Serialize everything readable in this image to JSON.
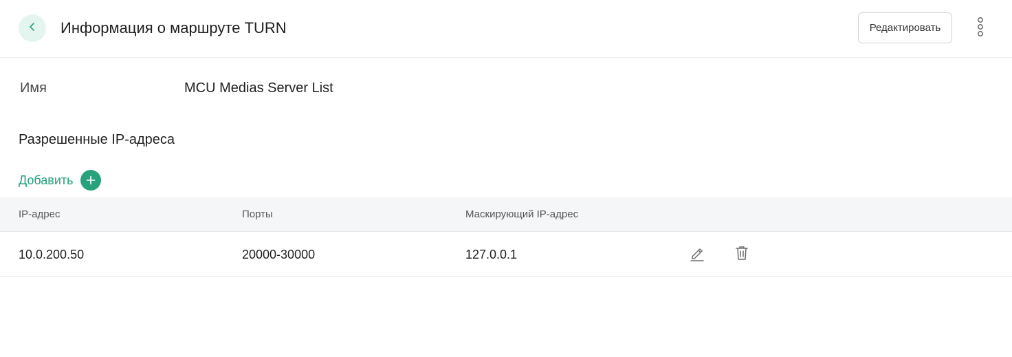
{
  "header": {
    "title": "Информация о маршруте TURN",
    "edit_label": "Редактировать",
    "back_icon": "chevron-left-icon",
    "more_icon": "more-vertical-icon"
  },
  "details": {
    "name_label": "Имя",
    "name_value": "MCU Medias Server List"
  },
  "allowed_ips": {
    "section_title": "Разрешенные IP-адреса",
    "add_label": "Добавить",
    "columns": [
      "IP-адрес",
      "Порты",
      "Маскирующий IP-адрес"
    ],
    "rows": [
      {
        "ip": "10.0.200.50",
        "ports": "20000-30000",
        "mask_ip": "127.0.0.1"
      }
    ]
  },
  "colors": {
    "accent": "#26a37c",
    "accent_text": "#23a07a",
    "back_bg": "#e4f4ee",
    "table_header_bg": "#f5f6f7"
  }
}
